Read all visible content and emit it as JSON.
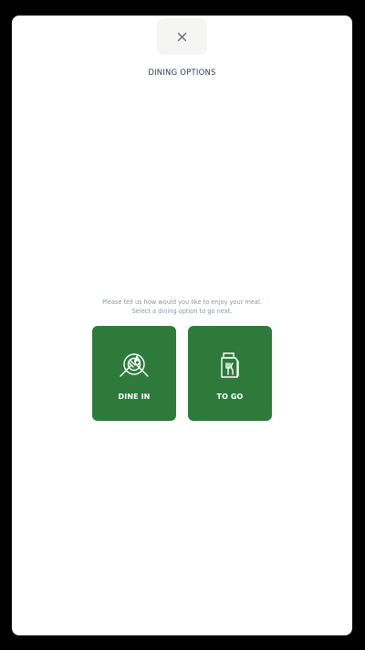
{
  "header": {
    "close_icon": "close-icon",
    "title": "DINING OPTIONS"
  },
  "prompt": {
    "line1": "Please tell us how would you like to enjoy your meal.",
    "line2": "Select a dining option to go next."
  },
  "options": [
    {
      "label": "DINE IN",
      "icon": "plate-cutlery-icon"
    },
    {
      "label": "TO GO",
      "icon": "takeaway-bag-icon"
    }
  ],
  "colors": {
    "accent": "#2d7a3b",
    "frame": "#000000",
    "title_text": "#2f3a4f",
    "prompt_text": "#8a96a8",
    "close_bg": "#f5f5f3"
  }
}
